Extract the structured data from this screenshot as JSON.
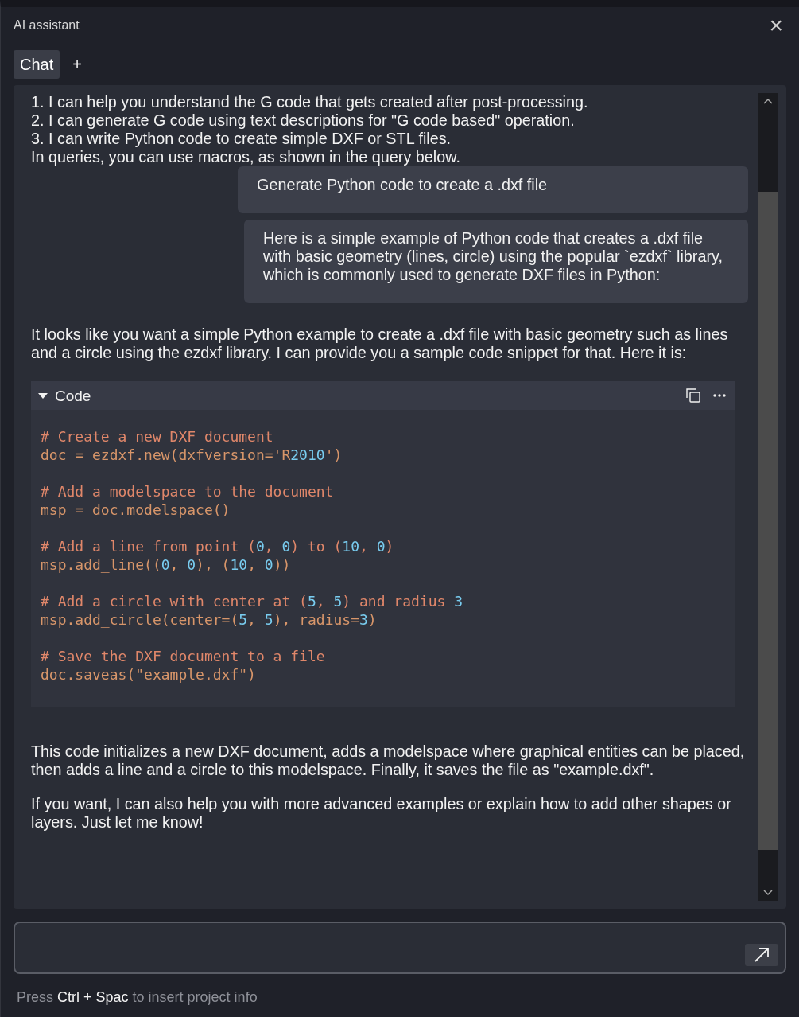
{
  "window": {
    "title": "AI assistant",
    "close": "×"
  },
  "tabs": [
    {
      "label": "Chat",
      "selected": true
    },
    {
      "label": "+",
      "selected": false
    }
  ],
  "messages": [
    {
      "kind": "assistant",
      "lines": [
        "1. I can help you understand the G code that gets created after post-processing.",
        "2. I can generate G code using text descriptions for \"G code based\" operation.",
        "3. I can write Python code to create simple DXF or STL files.",
        "In queries, you can use macros, as shown in the query below."
      ]
    },
    {
      "kind": "user",
      "lines": [
        "Generate Python code to create a .dxf file"
      ]
    },
    {
      "kind": "user",
      "lines": [
        "Here is a simple example of Python code that creates a .dxf file with basic geometry (lines, circle) using the popular `ezdxf` library, which is commonly used to generate DXF files in Python:"
      ]
    },
    {
      "kind": "assistant",
      "lines": [
        "It looks like you want a simple Python example to create a .dxf file with basic geometry such as lines and a circle using the ezdxf library. I can provide you a sample code snippet for that. Here it is:"
      ]
    },
    {
      "kind": "code",
      "title": "Code",
      "expanded": true,
      "snippets": [
        [
          [
            {
              "t": "# Create a new DXF document",
              "kind": "comment"
            }
          ],
          [
            {
              "t": "doc = ezdxf.new(dxfversion='R",
              "kind": "plain"
            },
            {
              "t": "2010",
              "kind": "number"
            },
            {
              "t": "')",
              "kind": "plain"
            }
          ]
        ],
        [
          [
            {
              "t": "# Add a modelspace to the document",
              "kind": "comment"
            }
          ],
          [
            {
              "t": "msp = doc.modelspace()",
              "kind": "plain"
            }
          ]
        ],
        [
          [
            {
              "t": "# Add a line from point (",
              "kind": "comment"
            },
            {
              "t": "0",
              "kind": "number"
            },
            {
              "t": ", ",
              "kind": "comment"
            },
            {
              "t": "0",
              "kind": "number"
            },
            {
              "t": ") to (",
              "kind": "comment"
            },
            {
              "t": "10",
              "kind": "number"
            },
            {
              "t": ", ",
              "kind": "comment"
            },
            {
              "t": "0",
              "kind": "number"
            },
            {
              "t": ")",
              "kind": "comment"
            }
          ],
          [
            {
              "t": "msp.add_line((",
              "kind": "plain"
            },
            {
              "t": "0",
              "kind": "number"
            },
            {
              "t": ", ",
              "kind": "plain"
            },
            {
              "t": "0",
              "kind": "number"
            },
            {
              "t": "), (",
              "kind": "plain"
            },
            {
              "t": "10",
              "kind": "number"
            },
            {
              "t": ", ",
              "kind": "plain"
            },
            {
              "t": "0",
              "kind": "number"
            },
            {
              "t": "))",
              "kind": "plain"
            }
          ]
        ],
        [
          [
            {
              "t": "# Add a circle with center at (",
              "kind": "comment"
            },
            {
              "t": "5",
              "kind": "number"
            },
            {
              "t": ", ",
              "kind": "comment"
            },
            {
              "t": "5",
              "kind": "number"
            },
            {
              "t": ") and radius ",
              "kind": "comment"
            },
            {
              "t": "3",
              "kind": "number"
            }
          ],
          [
            {
              "t": "msp.add_circle(center=(",
              "kind": "plain"
            },
            {
              "t": "5",
              "kind": "number"
            },
            {
              "t": ", ",
              "kind": "plain"
            },
            {
              "t": "5",
              "kind": "number"
            },
            {
              "t": "), radius=",
              "kind": "plain"
            },
            {
              "t": "3",
              "kind": "number"
            },
            {
              "t": ")",
              "kind": "plain"
            }
          ]
        ],
        [
          [
            {
              "t": "# Save the DXF document to a file",
              "kind": "comment"
            }
          ],
          [
            {
              "t": "doc.saveas(\"example.dxf\")",
              "kind": "plain"
            }
          ]
        ]
      ]
    },
    {
      "kind": "assistant",
      "lines": [
        "This code initializes a new DXF document, adds a modelspace where graphical entities can be placed, then adds a line and a circle to this modelspace. Finally, it saves the file as \"example.dxf\"."
      ]
    },
    {
      "kind": "assistant",
      "lines": [
        "If you want, I can also help you with more advanced examples or explain how to add other shapes or layers. Just let me know!"
      ]
    }
  ],
  "hint": {
    "before": "Press ",
    "keys": "Ctrl + Spac",
    "after": " to insert project info"
  }
}
